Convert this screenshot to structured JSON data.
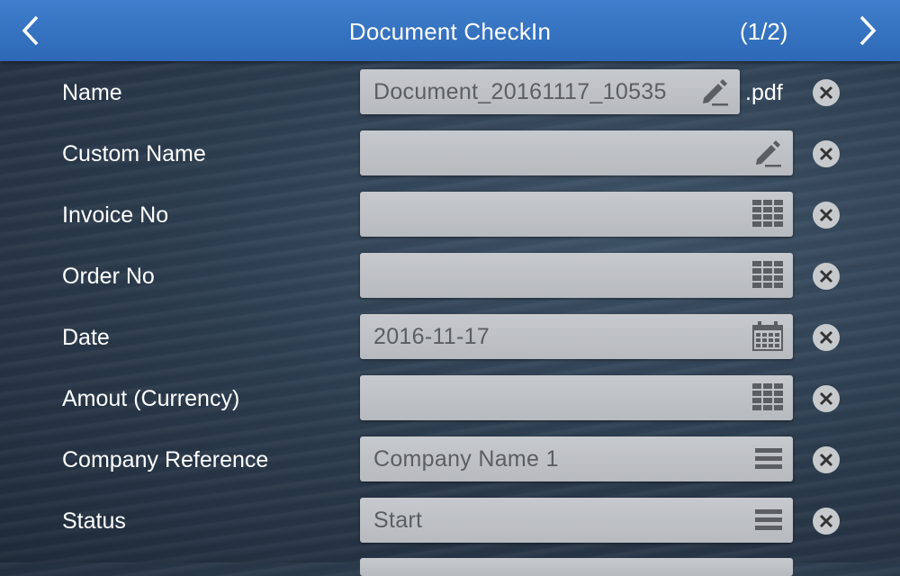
{
  "header": {
    "title": "Document CheckIn",
    "pager": "(1/2)"
  },
  "form": {
    "rows": [
      {
        "label": "Name",
        "value": "Document_20161117_10535",
        "suffix": ".pdf",
        "icon": "pencil-icon"
      },
      {
        "label": "Custom Name",
        "value": "",
        "icon": "pencil-icon"
      },
      {
        "label": "Invoice No",
        "value": "",
        "icon": "keypad-icon"
      },
      {
        "label": "Order No",
        "value": "",
        "icon": "keypad-icon"
      },
      {
        "label": "Date",
        "value": "2016-11-17",
        "icon": "calendar-icon"
      },
      {
        "label": "Amout (Currency)",
        "value": "",
        "icon": "keypad-icon"
      },
      {
        "label": "Company Reference",
        "value": "Company Name 1",
        "icon": "list-icon"
      },
      {
        "label": "Status",
        "value": "Start",
        "icon": "list-icon"
      }
    ]
  },
  "colors": {
    "header": "#3072bd",
    "field": "#c0c3c7",
    "icon": "#5b5e62"
  }
}
